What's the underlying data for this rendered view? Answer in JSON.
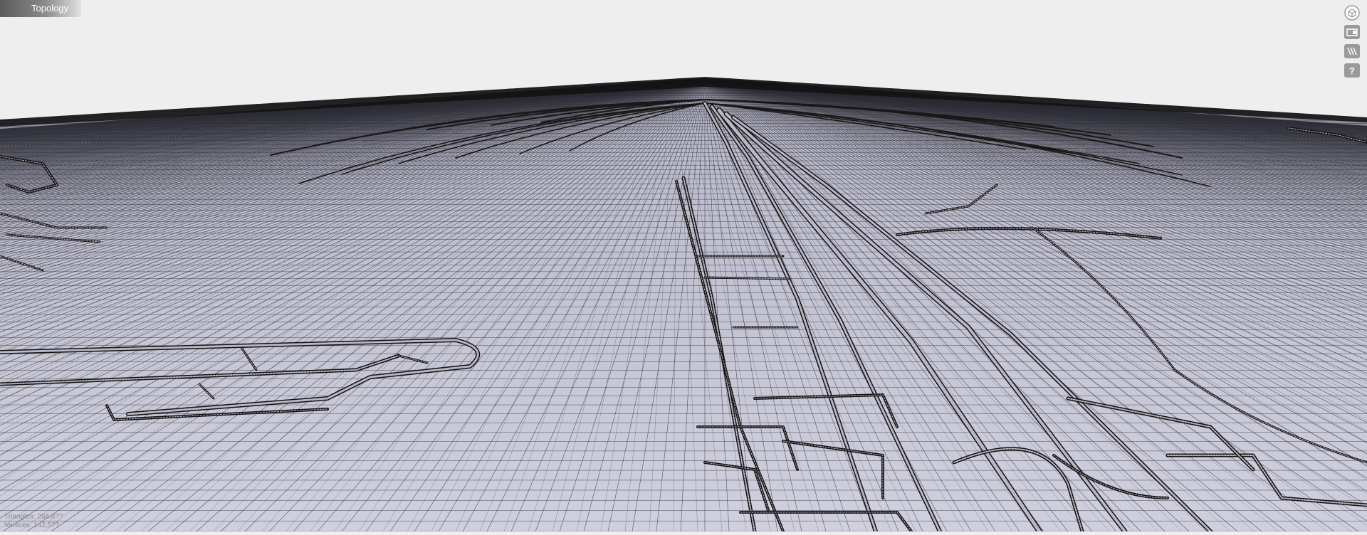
{
  "viewer": {
    "title": "Topology",
    "stats": {
      "triangles": "Triangles: 284,8??",
      "vertices": "Vertices: 142,5??"
    },
    "toolbar": [
      {
        "name": "view-cube-icon",
        "label": ""
      },
      {
        "name": "window-icon",
        "label": ""
      },
      {
        "name": "texture-icon",
        "label": ""
      },
      {
        "name": "help-icon",
        "label": "?"
      }
    ],
    "colors": {
      "background": "#eeeeee",
      "ground": "#c8c8d6",
      "mesh": "#1a1a1a"
    }
  }
}
